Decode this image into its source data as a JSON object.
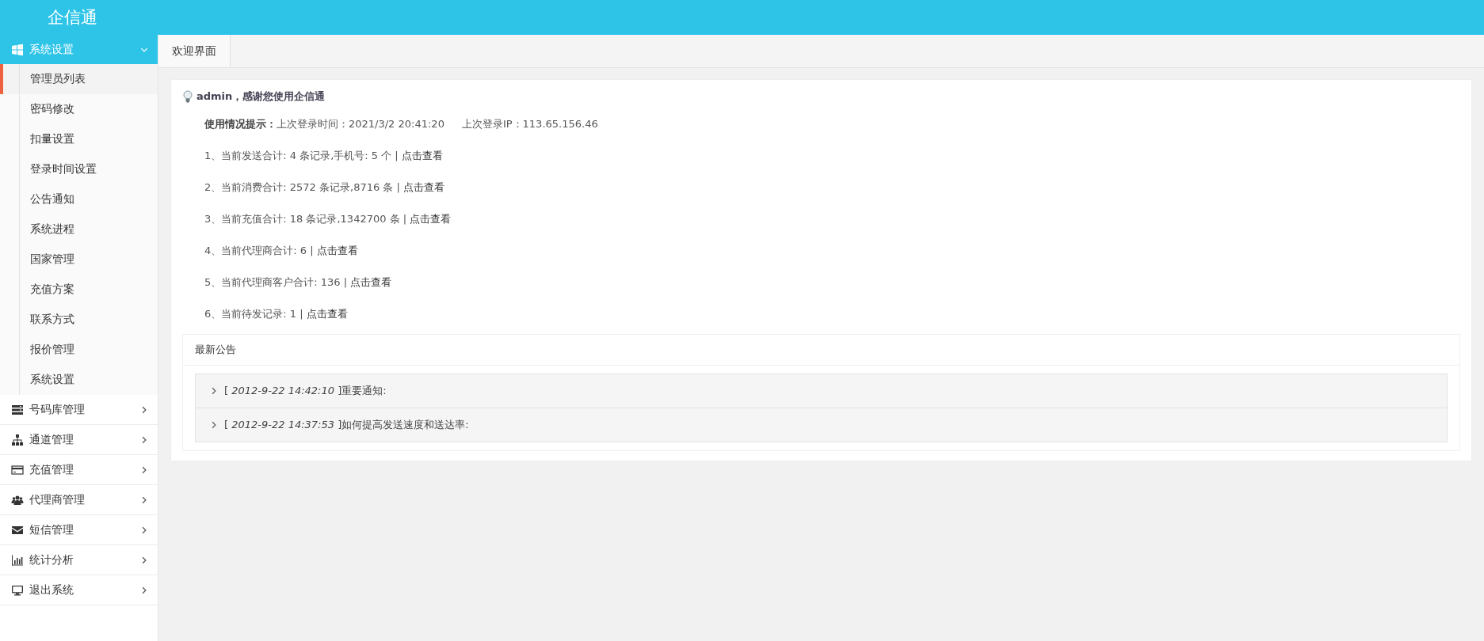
{
  "header": {
    "title": "企信通"
  },
  "sidebar": {
    "groups": [
      {
        "label": "系统设置",
        "expanded": true,
        "children": [
          {
            "label": "管理员列表",
            "selected": true
          },
          {
            "label": "密码修改",
            "selected": false
          },
          {
            "label": "扣量设置",
            "selected": false
          },
          {
            "label": "登录时间设置",
            "selected": false
          },
          {
            "label": "公告通知",
            "selected": false
          },
          {
            "label": "系统进程",
            "selected": false
          },
          {
            "label": "国家管理",
            "selected": false
          },
          {
            "label": "充值方案",
            "selected": false
          },
          {
            "label": "联系方式",
            "selected": false
          },
          {
            "label": "报价管理",
            "selected": false
          },
          {
            "label": "系统设置",
            "selected": false
          }
        ]
      },
      {
        "label": "号码库管理",
        "expanded": false
      },
      {
        "label": "通道管理",
        "expanded": false
      },
      {
        "label": "充值管理",
        "expanded": false
      },
      {
        "label": "代理商管理",
        "expanded": false
      },
      {
        "label": "短信管理",
        "expanded": false
      },
      {
        "label": "统计分析",
        "expanded": false
      },
      {
        "label": "退出系统",
        "expanded": false
      }
    ]
  },
  "tabs": [
    {
      "label": "欢迎界面",
      "selected": true
    }
  ],
  "welcome": {
    "greeting": "admin，感谢您使用企信通",
    "usage": {
      "label": "使用情况提示：",
      "last_login_time": "上次登录时间：2021/3/2 20:41:20",
      "last_login_ip": "上次登录IP：113.65.156.46"
    },
    "stats": [
      {
        "text": "1、当前发送合计: 4 条记录,手机号: 5 个 |",
        "link": "点击查看"
      },
      {
        "text": "2、当前消费合计: 2572 条记录,8716 条 |",
        "link": "点击查看"
      },
      {
        "text": "3、当前充值合计: 18 条记录,1342700 条 |",
        "link": "点击查看"
      },
      {
        "text": "4、当前代理商合计: 6 |",
        "link": "点击查看"
      },
      {
        "text": "5、当前代理商客户合计: 136 |",
        "link": "点击查看"
      },
      {
        "text": "6、当前待发记录: 1 |",
        "link": "点击查看"
      }
    ]
  },
  "notices": {
    "title": "最新公告",
    "items": [
      {
        "text": "[ *2012-9-22 14:42:10* ]重要通知:"
      },
      {
        "text": "[ *2012-9-22 14:37:53* ]如何提高发送速度和送达率:"
      }
    ]
  }
}
